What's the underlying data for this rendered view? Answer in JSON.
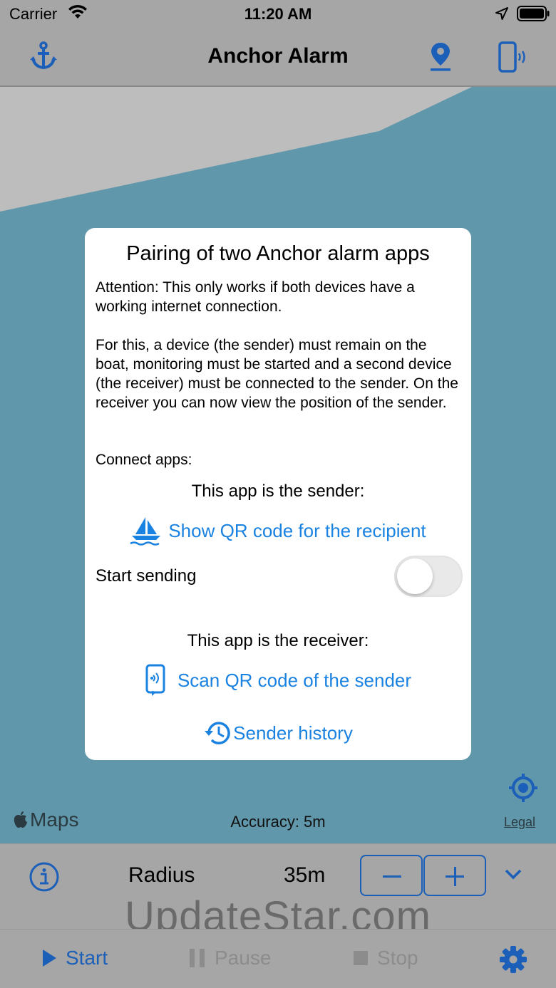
{
  "status_bar": {
    "carrier": "Carrier",
    "time": "11:20 AM"
  },
  "nav_bar": {
    "title": "Anchor Alarm",
    "left_icon": "anchor-icon",
    "right_icons": [
      "location-pin-icon",
      "phone-signal-icon"
    ],
    "accent_color": "#1c5fb8"
  },
  "map": {
    "water_color": "#6197aa",
    "land_color": "#bdbdbd",
    "maps_logo": "Maps",
    "accuracy": "Accuracy: 5m",
    "legal": "Legal"
  },
  "dialog": {
    "title": "Pairing of two Anchor alarm apps",
    "attention": "Attention: This only works if both devices have a working internet connection.",
    "description": "For this, a device (the sender) must remain on the boat, monitoring must be started and a second device (the receiver) must be connected to the sender. On the receiver you can now view the position of the sender.",
    "connect_label": "Connect apps:",
    "sender_label": "This app is the sender:",
    "show_qr_link": "Show QR code for the recipient",
    "start_sending_label": "Start sending",
    "start_sending_on": false,
    "receiver_label": "This app is the receiver:",
    "scan_qr_link": "Scan QR code of the sender",
    "sender_history_link": "Sender history",
    "link_color": "#1a82e0"
  },
  "controls": {
    "radius_label": "Radius",
    "radius_value": "35m",
    "watermark": "UpdateStar.com"
  },
  "tab_bar": {
    "start": "Start",
    "pause": "Pause",
    "stop": "Stop"
  }
}
